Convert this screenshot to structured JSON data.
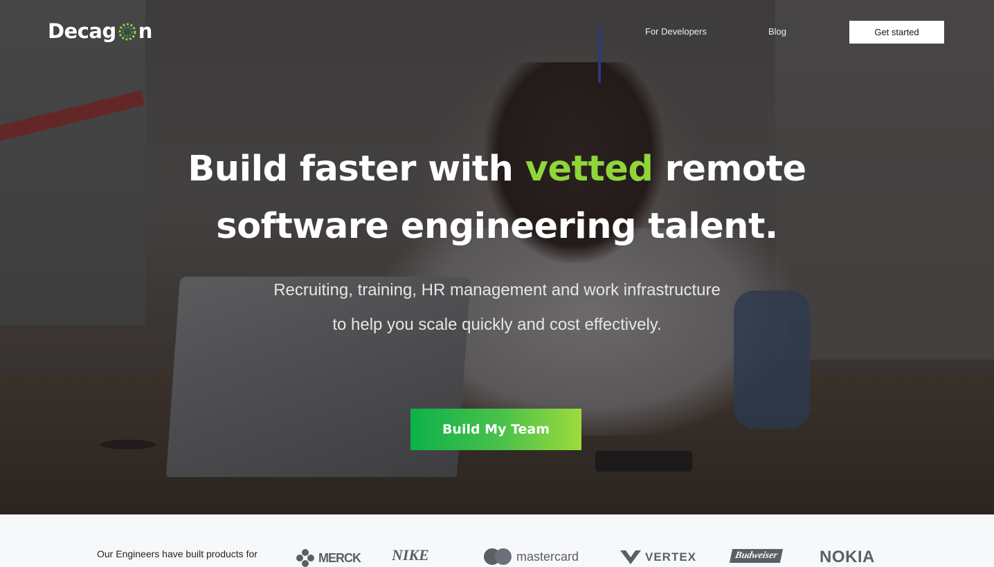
{
  "brand": {
    "name_part1": "Decag",
    "name_part2": "n",
    "logo_icon": "decagon-o-icon",
    "accent_colors": [
      "#8fd63a",
      "#1aa84a"
    ]
  },
  "nav": {
    "links": [
      "For Developers",
      "Blog"
    ],
    "cta": "Get started"
  },
  "hero": {
    "headline_before": "Build faster with ",
    "headline_accent": "vetted",
    "headline_after": " remote",
    "headline_line2": "software engineering talent.",
    "sub_line1": "Recruiting, training, HR management and work infrastructure",
    "sub_line2": "to help you scale quickly and cost effectively.",
    "cta": "Build My Team",
    "accent_color": "#8fd63a"
  },
  "clients": {
    "label": "Our Engineers have built products for",
    "logos": [
      "MERCK",
      "NIKE",
      "mastercard",
      "VERTEX",
      "Budweiser",
      "NOKIA"
    ]
  }
}
